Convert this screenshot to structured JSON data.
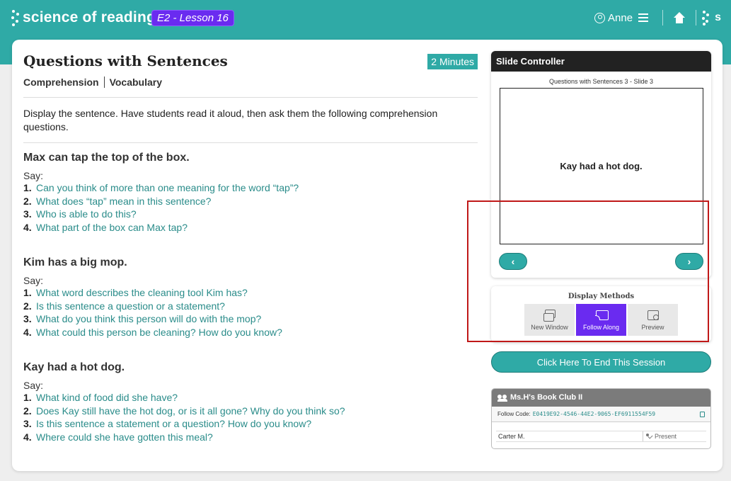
{
  "header": {
    "brand": "science of reading",
    "lesson_badge": "E2 - Lesson 16",
    "user_name": "Anne",
    "s_label": "s"
  },
  "lesson": {
    "title": "Questions with Sentences",
    "duration": "2 Minutes",
    "tags": [
      "Comprehension",
      "Vocabulary"
    ],
    "intro": "Display the sentence. Have students read it aloud, then ask them the following comprehension questions.",
    "sections": [
      {
        "heading": "Max can tap the top of the box.",
        "say": "Say:",
        "questions": [
          {
            "num": "1.",
            "text": "Can you think of more than one meaning for the word “tap”?"
          },
          {
            "num": "2.",
            "text": "What does “tap” mean in this sentence?"
          },
          {
            "num": "3.",
            "text": "Who is able to do this?"
          },
          {
            "num": "4.",
            "text": "What part of the box can Max tap?"
          }
        ]
      },
      {
        "heading": "Kim has a big mop.",
        "say": "Say:",
        "questions": [
          {
            "num": "1.",
            "text": "What word describes the cleaning tool Kim has?"
          },
          {
            "num": "2.",
            "text": "Is this sentence a question or a statement?"
          },
          {
            "num": "3.",
            "text": "What do you think this person will do with the mop?"
          },
          {
            "num": "4.",
            "text": "What could this person be cleaning? How do you know?"
          }
        ]
      },
      {
        "heading": "Kay had a hot dog.",
        "say": "Say:",
        "questions": [
          {
            "num": "1.",
            "text": "What kind of food did she have?"
          },
          {
            "num": "2.",
            "text": "Does Kay still have the hot dog, or is it all gone? Why do you think so?"
          },
          {
            "num": "3.",
            "text": "Is this sentence a statement or a question? How do you know?"
          },
          {
            "num": "4.",
            "text": "Where could she have gotten this meal?"
          }
        ]
      }
    ]
  },
  "slide_controller": {
    "title": "Slide Controller",
    "slide_caption": "Questions with Sentences 3 - Slide 3",
    "slide_text": "Kay had a hot dog.",
    "prev_icon": "chevron-left-icon",
    "next_icon": "chevron-right-icon"
  },
  "display_methods": {
    "title": "Display Methods",
    "options": [
      {
        "label": "New Window",
        "icon": "new-window-icon",
        "active": false
      },
      {
        "label": "Follow Along",
        "icon": "cast-icon",
        "active": true
      },
      {
        "label": "Preview",
        "icon": "preview-icon",
        "active": false
      }
    ]
  },
  "end_session_label": "Click Here To End This Session",
  "book_club": {
    "title": "Ms.H's Book Club II",
    "follow_label": "Follow Code:",
    "follow_code": "E0419E92-4546-44E2-9065-EF6911554F59",
    "students": [
      {
        "name": "Carter M.",
        "status": "Present"
      }
    ]
  },
  "colors": {
    "teal": "#2faaa6",
    "purple": "#6a2bf0",
    "highlight_red": "#c01818"
  }
}
